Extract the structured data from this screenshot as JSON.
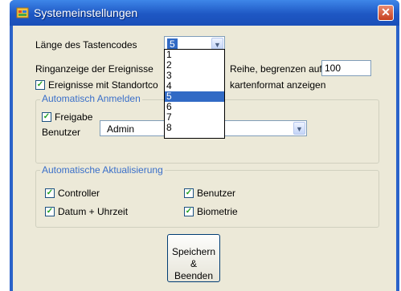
{
  "window": {
    "title": "Systemeinstellungen"
  },
  "fields": {
    "code_length_label": "Länge des Tastencodes",
    "code_length_value": "5",
    "ring_label_left": "Ringanzeige der Ereignisse",
    "ring_label_right": "Reihe, begrenzen auf",
    "ring_limit_value": "100",
    "events_checkbox_left": "Ereignisse mit Standortco",
    "events_checkbox_right": "kartenformat anzeigen"
  },
  "auto_login": {
    "title": "Automatisch Anmelden",
    "release_label": "Freigabe",
    "user_label": "Benutzer",
    "user_value": "Admin"
  },
  "auto_update": {
    "title": "Automatische Aktualisierung",
    "items": [
      "Controller",
      "Benutzer",
      "Datum + Uhrzeit",
      "Biometrie"
    ]
  },
  "dropdown": {
    "options": [
      "1",
      "2",
      "3",
      "4",
      "5",
      "6",
      "7",
      "8"
    ],
    "selected": "5"
  },
  "save_button": {
    "line1": "Speichern &",
    "line2": "Beenden"
  },
  "icons": {
    "app": "window-icon",
    "close": "close-icon",
    "check": "checkmark-icon",
    "arrow": "chevron-down-icon"
  }
}
